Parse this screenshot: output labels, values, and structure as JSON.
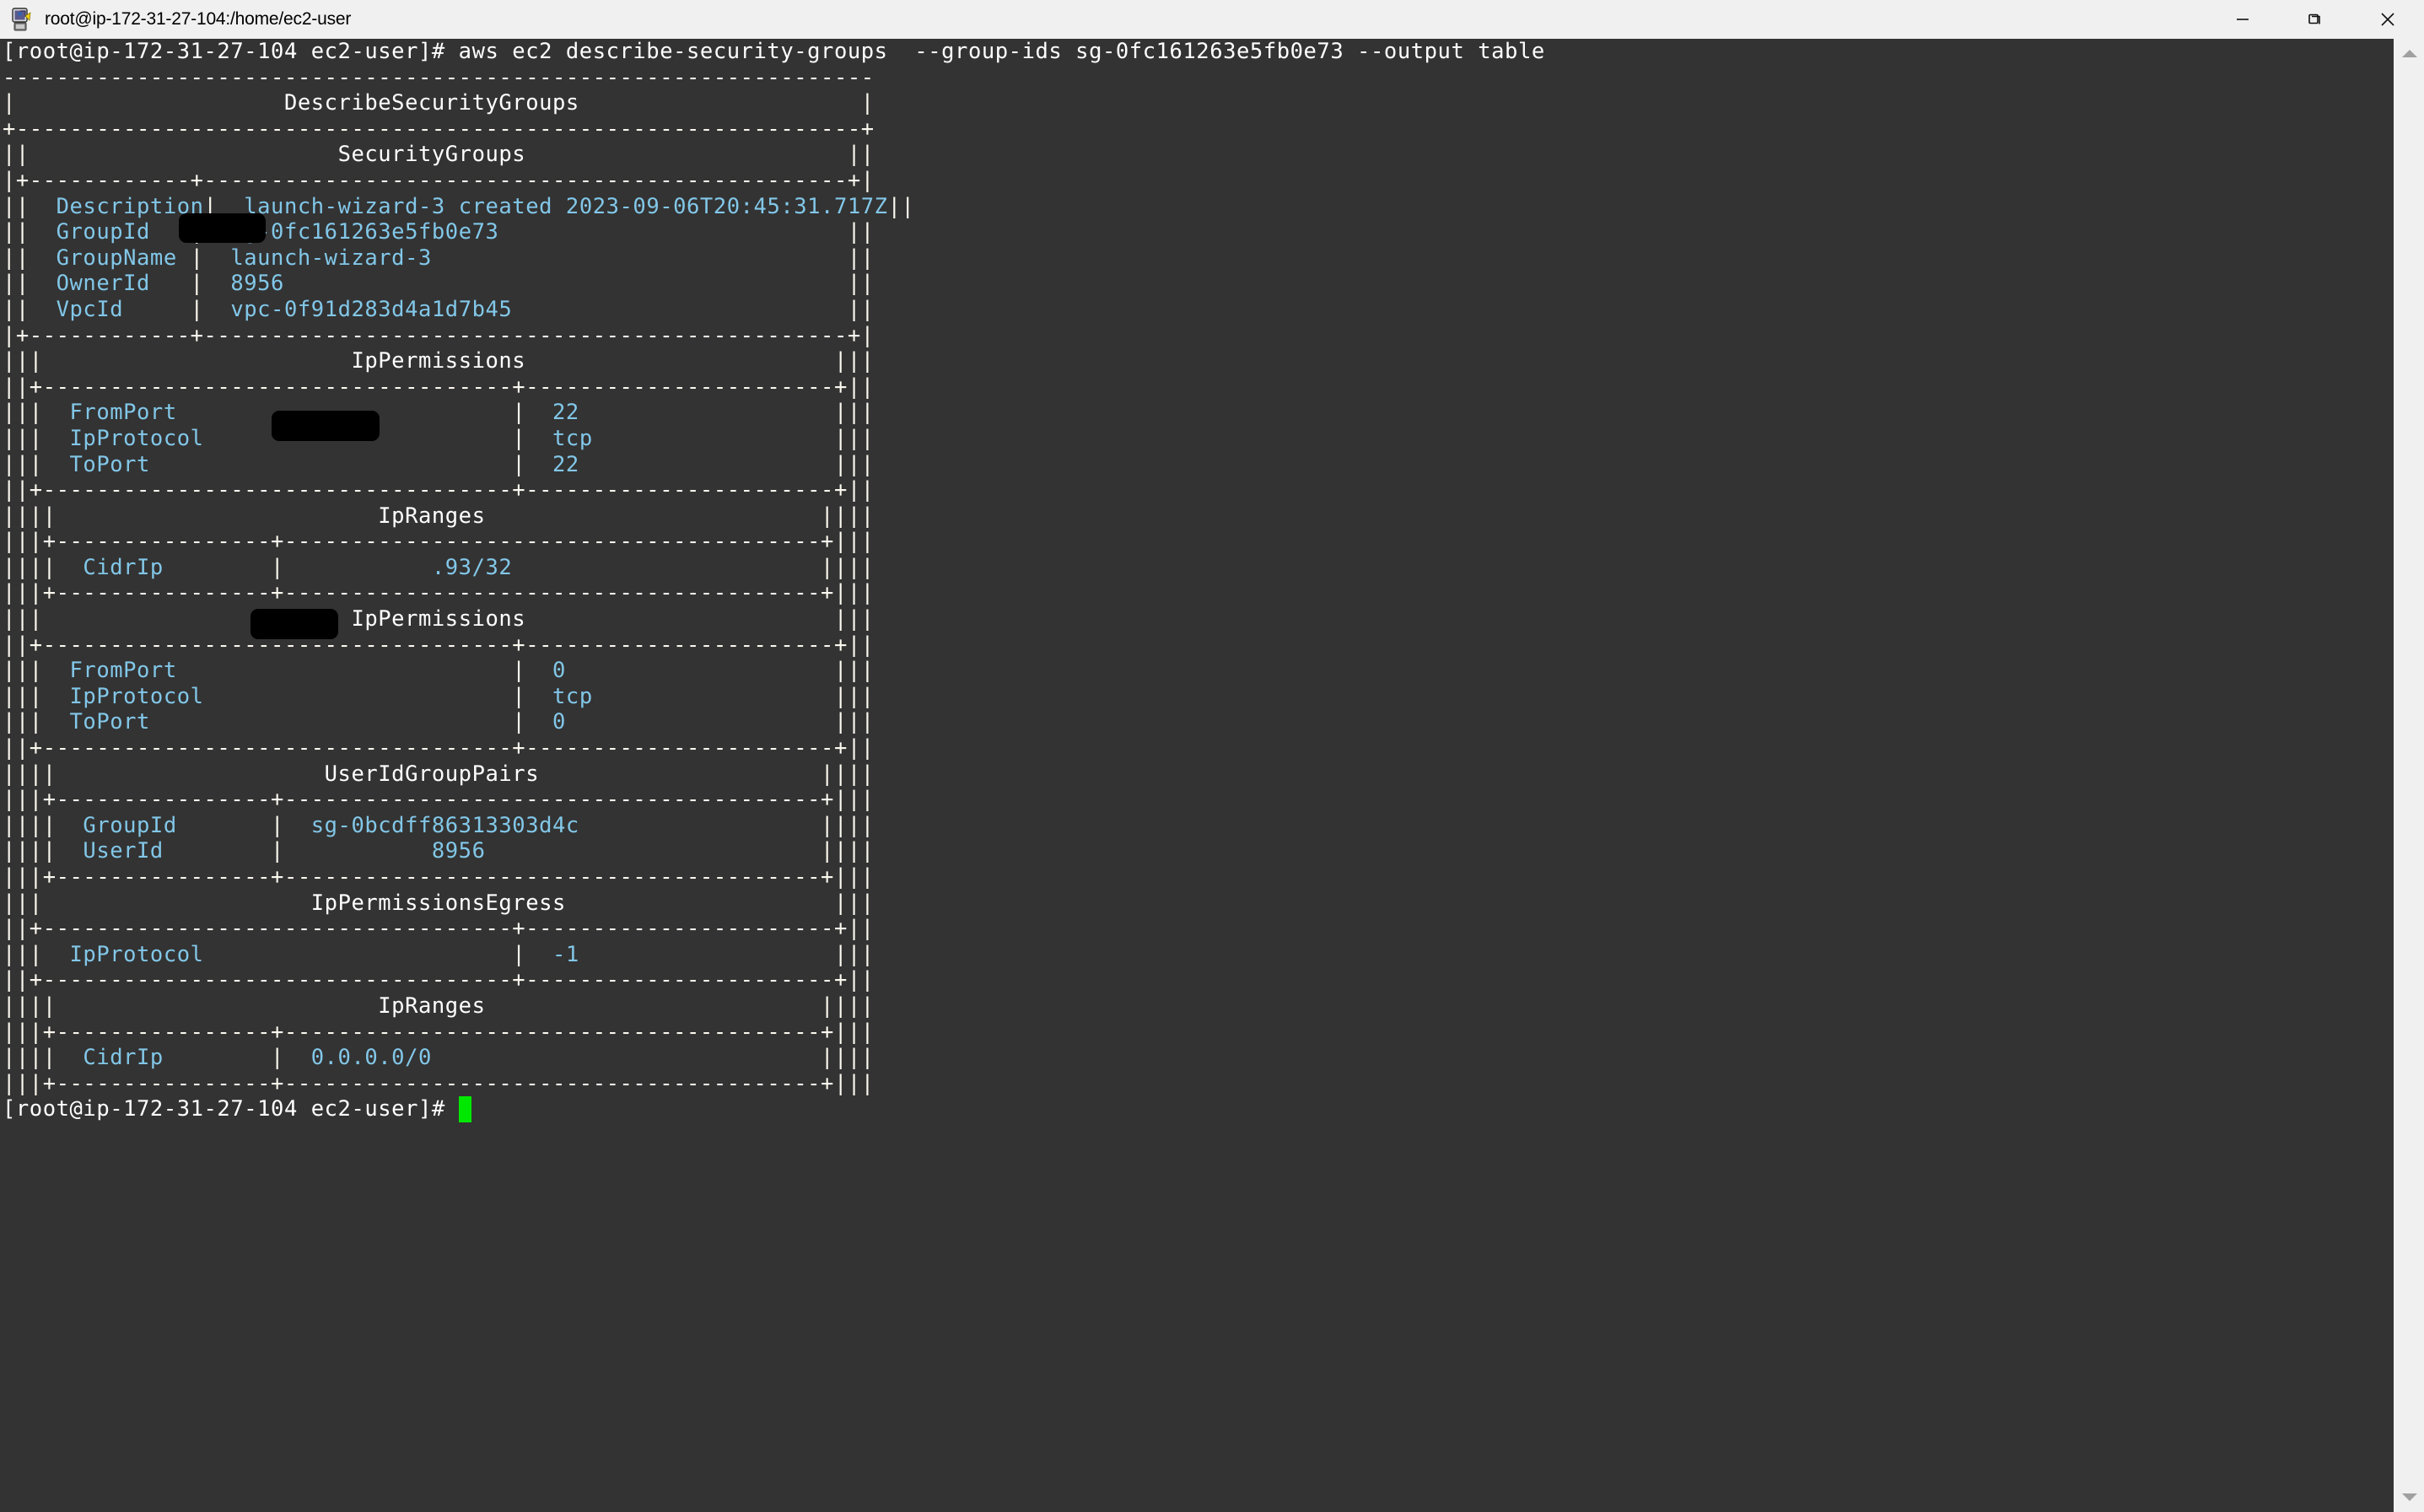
{
  "window": {
    "title": "root@ip-172-31-27-104:/home/ec2-user",
    "icon": "putty-icon",
    "controls": {
      "minimize_label": "Minimize",
      "restore_label": "Restore",
      "close_label": "Close"
    }
  },
  "colors": {
    "terminal_background": "#333333",
    "terminal_foreground": "#ffffff",
    "value_text": "#82c7e8",
    "cursor": "#00e800",
    "titlebar_background": "#f0f0f0",
    "redaction": "#000000"
  },
  "terminal": {
    "prompt": "[root@ip-172-31-27-104 ec2-user]#",
    "command": "aws ec2 describe-security-groups  --group-ids sg-0fc161263e5fb0e73 --output table",
    "final_prompt": "[root@ip-172-31-27-104 ec2-user]#",
    "cursor_visible": true,
    "output_lines": [
      "-----------------------------------------------------------------",
      "|                    DescribeSecurityGroups                     |",
      "+---------------------------------------------------------------+",
      "||                       SecurityGroups                        ||",
      "|+------------+------------------------------------------------+|",
      "||  Description|  launch-wizard-3 created 2023-09-06T20:45:31.717Z  ||",
      "||  GroupId    |  sg-0fc161263e5fb0e73                          ||",
      "||  GroupName  |  launch-wizard-3                               ||",
      "||  OwnerId    |  XXXXXXXXXX8956                                ||",
      "||  VpcId      |  vpc-0f91d283d4a1d7b45                         ||",
      "|+------------+------------------------------------------------+|",
      "|||                     IpPermissions                         |||",
      "||+-------------------------------+--------------------------+||",
      "|||  FromPort                     |  22                      |||",
      "|||  IpProtocol                   |  tcp                     |||",
      "|||  ToPort                       |  22                      |||",
      "||+-------------------------------+--------------------------+||",
      "||||                    IpRanges                            ||||",
      "|||+--------------+------------------------------------+||||",
      "||||  CidrIp      |  XXXXXXXXX.93/32                   ||||",
      "|||+--------------+------------------------------------+||||",
      "|||                     IpPermissions                         |||",
      "||+-------------------------------+--------------------------+||",
      "|||  FromPort                     |  0                       |||",
      "|||  IpProtocol                   |  tcp                     |||",
      "|||  ToPort                       |  0                       |||",
      "||+-------------------------------+--------------------------+||",
      "||||                 UserIdGroupPairs                       ||||",
      "|||+--------------+------------------------------------+||||",
      "||||  GroupId     |  sg-0bcdff86313303d4c              ||||",
      "||||  UserId      |  XXXXXXXXXX8956                    ||||",
      "|||+--------------+------------------------------------+||||",
      "|||                  IpPermissionsEgress                      |||",
      "||+-------------------------------+--------------------------+||",
      "|||  IpProtocol                   |  -1                      |||",
      "||+-------------------------------+--------------------------+||",
      "||||                    IpRanges                            ||||",
      "|||+--------------+------------------------------------+||||",
      "||||  CidrIp      |  0.0.0.0/0                         ||||",
      "|||+--------------+------------------------------------+||||"
    ],
    "table": {
      "title": "DescribeSecurityGroups",
      "section": "SecurityGroups",
      "fields": [
        {
          "key": "Description",
          "value": "launch-wizard-3 created 2023-09-06T20:45:31.717Z"
        },
        {
          "key": "GroupId",
          "value": "sg-0fc161263e5fb0e73"
        },
        {
          "key": "GroupName",
          "value": "launch-wizard-3"
        },
        {
          "key": "OwnerId",
          "value": "8956",
          "redacted": true
        },
        {
          "key": "VpcId",
          "value": "vpc-0f91d283d4a1d7b45"
        }
      ],
      "ingress_rules": [
        {
          "section": "IpPermissions",
          "fields": [
            {
              "key": "FromPort",
              "value": "22"
            },
            {
              "key": "IpProtocol",
              "value": "tcp"
            },
            {
              "key": "ToPort",
              "value": "22"
            }
          ],
          "sub_section": "IpRanges",
          "sub_fields": [
            {
              "key": "CidrIp",
              "value": ".93/32",
              "redacted": true
            }
          ]
        },
        {
          "section": "IpPermissions",
          "fields": [
            {
              "key": "FromPort",
              "value": "0"
            },
            {
              "key": "IpProtocol",
              "value": "tcp"
            },
            {
              "key": "ToPort",
              "value": "0"
            }
          ],
          "sub_section": "UserIdGroupPairs",
          "sub_fields": [
            {
              "key": "GroupId",
              "value": "sg-0bcdff86313303d4c"
            },
            {
              "key": "UserId",
              "value": "8956",
              "redacted": true
            }
          ]
        }
      ],
      "egress_rules": [
        {
          "section": "IpPermissionsEgress",
          "fields": [
            {
              "key": "IpProtocol",
              "value": "-1"
            }
          ],
          "sub_section": "IpRanges",
          "sub_fields": [
            {
              "key": "CidrIp",
              "value": "0.0.0.0/0"
            }
          ]
        }
      ]
    }
  },
  "scrollbar": {
    "up_arrow": "triangle-up-icon",
    "down_arrow": "triangle-down-icon"
  }
}
